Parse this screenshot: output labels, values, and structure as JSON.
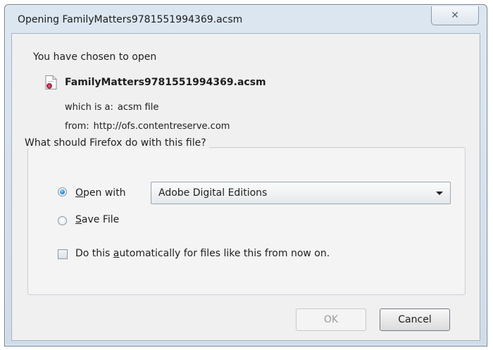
{
  "window": {
    "title": "Opening FamilyMatters9781551994369.acsm",
    "close_glyph": "✕"
  },
  "dialog": {
    "intro": "You have chosen to open",
    "file_name": "FamilyMatters9781551994369.acsm",
    "file_icon": "acsm-file-icon",
    "type_label": "which is a:",
    "type_value": "acsm file",
    "from_label": "from:",
    "from_value": "http://ofs.contentreserve.com"
  },
  "action_group": {
    "legend": "What should Firefox do with this file?",
    "open_with": {
      "mnemonic": "O",
      "rest": "pen with",
      "selected": true,
      "app": "Adobe Digital Editions"
    },
    "save_file": {
      "mnemonic": "S",
      "rest": "ave File",
      "selected": false
    },
    "auto": {
      "before": "Do this ",
      "mnemonic": "a",
      "after": "utomatically for files like this from now on.",
      "checked": false
    }
  },
  "buttons": {
    "ok": "OK",
    "cancel": "Cancel"
  },
  "colors": {
    "frame": "#dbe6f1",
    "client": "#f0f0f0",
    "radio_selected": "#2a8ad8"
  }
}
